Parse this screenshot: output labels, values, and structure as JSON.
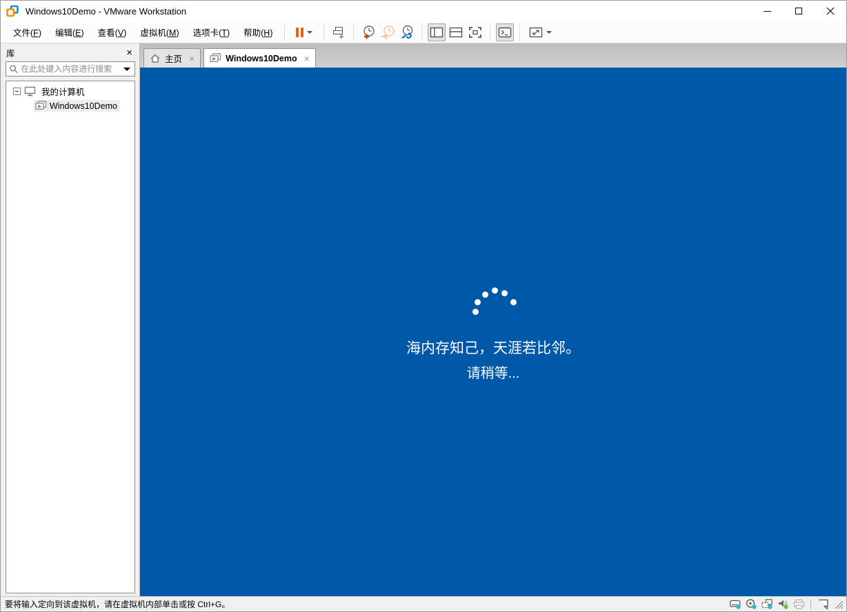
{
  "titlebar": {
    "title": "Windows10Demo - VMware Workstation",
    "app_icon": "vmware-logo"
  },
  "window_controls": {
    "minimize": "minimize-icon",
    "maximize": "maximize-icon",
    "close": "close-icon"
  },
  "menubar": {
    "items": [
      {
        "pre": "文件(",
        "key": "F",
        "post": ")"
      },
      {
        "pre": "编辑(",
        "key": "E",
        "post": ")"
      },
      {
        "pre": "查看(",
        "key": "V",
        "post": ")"
      },
      {
        "pre": "虚拟机(",
        "key": "M",
        "post": ")"
      },
      {
        "pre": "选项卡(",
        "key": "T",
        "post": ")"
      },
      {
        "pre": "帮助(",
        "key": "H",
        "post": ")"
      }
    ]
  },
  "toolbar": {
    "buttons": [
      {
        "name": "suspend",
        "icon": "pause-icon",
        "state": "normal",
        "has_dropdown": true
      },
      {
        "name": "send-ctrl-alt-del",
        "icon": "keyboard-send-icon",
        "state": "normal"
      },
      {
        "name": "take-snapshot",
        "icon": "clock-plus-icon",
        "state": "normal"
      },
      {
        "name": "revert-snapshot",
        "icon": "clock-revert-icon",
        "state": "disabled"
      },
      {
        "name": "manage-snapshots",
        "icon": "clock-wrench-icon",
        "state": "normal"
      },
      {
        "name": "show-library",
        "icon": "panel-left-icon",
        "state": "pressed"
      },
      {
        "name": "show-thumbnail-bar",
        "icon": "panel-bottom-icon",
        "state": "normal"
      },
      {
        "name": "fullscreen",
        "icon": "fullscreen-icon",
        "state": "normal"
      },
      {
        "name": "console-view",
        "icon": "console-icon",
        "state": "pressed"
      },
      {
        "name": "stretch-guest",
        "icon": "stretch-icon",
        "state": "normal",
        "has_dropdown": true
      }
    ]
  },
  "library": {
    "title": "库",
    "close_icon": "close-icon",
    "search_icon": "search-icon",
    "search_placeholder": "在此处键入内容进行搜索",
    "tree": {
      "root": {
        "label": "我的计算机",
        "icon": "computer-icon",
        "expanded": true
      },
      "children": [
        {
          "label": "Windows10Demo",
          "icon": "vm-running-icon",
          "selected": true
        }
      ]
    }
  },
  "tabs": [
    {
      "label": "主页",
      "icon": "home-icon",
      "active": false
    },
    {
      "label": "Windows10Demo",
      "icon": "vm-running-icon",
      "active": true
    }
  ],
  "vm_screen": {
    "background": "#0058a8",
    "spinner": "windows-loading-dots",
    "message_line1": "海内存知己，天涯若比邻。",
    "message_line2": "请稍等..."
  },
  "statusbar": {
    "message": "要将输入定向到该虚拟机，请在虚拟机内部单击或按 Ctrl+G。",
    "devices": [
      {
        "name": "hard-disk",
        "icon": "hard-disk-icon",
        "indicator": "#2fb8c6"
      },
      {
        "name": "cd-dvd",
        "icon": "cd-icon",
        "indicator": "#2fb8c6"
      },
      {
        "name": "network-adapter",
        "icon": "network-icon",
        "indicator": "#2fb8c6"
      },
      {
        "name": "sound",
        "icon": "speaker-icon",
        "indicator": "#72bf44"
      },
      {
        "name": "printer",
        "icon": "printer-icon",
        "state": "disabled"
      }
    ],
    "message_log_icon": "message-log-icon",
    "resize_grip_icon": "resize-grip-icon"
  },
  "colors": {
    "vm_screen_bg": "#0058a8",
    "pause_orange": "#e8640a",
    "indicator_teal": "#2fb8c6",
    "indicator_green": "#72bf44",
    "vm_play_green": "#3aa935"
  }
}
